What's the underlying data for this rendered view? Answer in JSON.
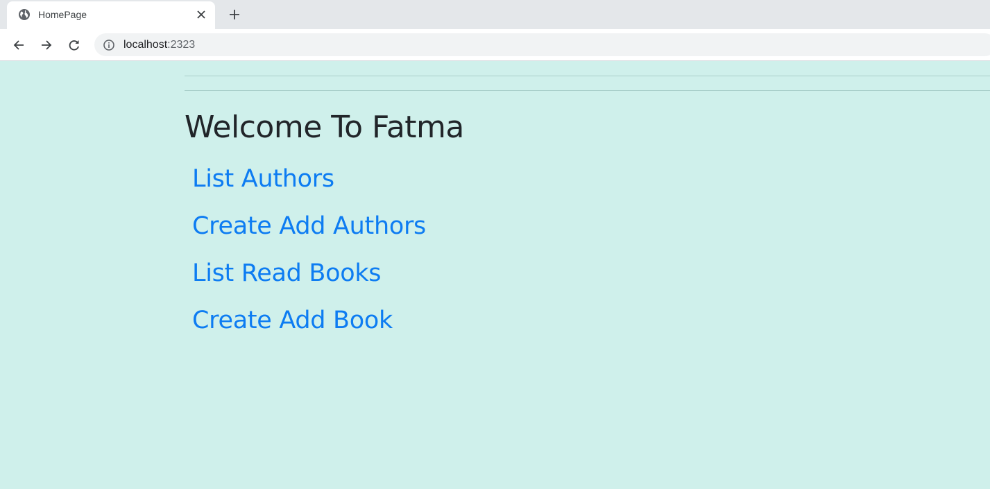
{
  "browser": {
    "tab": {
      "title": "HomePage",
      "favicon": "globe-icon"
    },
    "address_bar": {
      "host": "localhost",
      "port": ":2323"
    }
  },
  "page": {
    "heading": "Welcome To Fatma",
    "links": [
      {
        "label": "List Authors"
      },
      {
        "label": "Create Add Authors"
      },
      {
        "label": "List Read Books"
      },
      {
        "label": "Create Add Book"
      }
    ],
    "colors": {
      "background": "#cff0eb",
      "link": "#0d7cf2",
      "heading": "#212529"
    }
  }
}
